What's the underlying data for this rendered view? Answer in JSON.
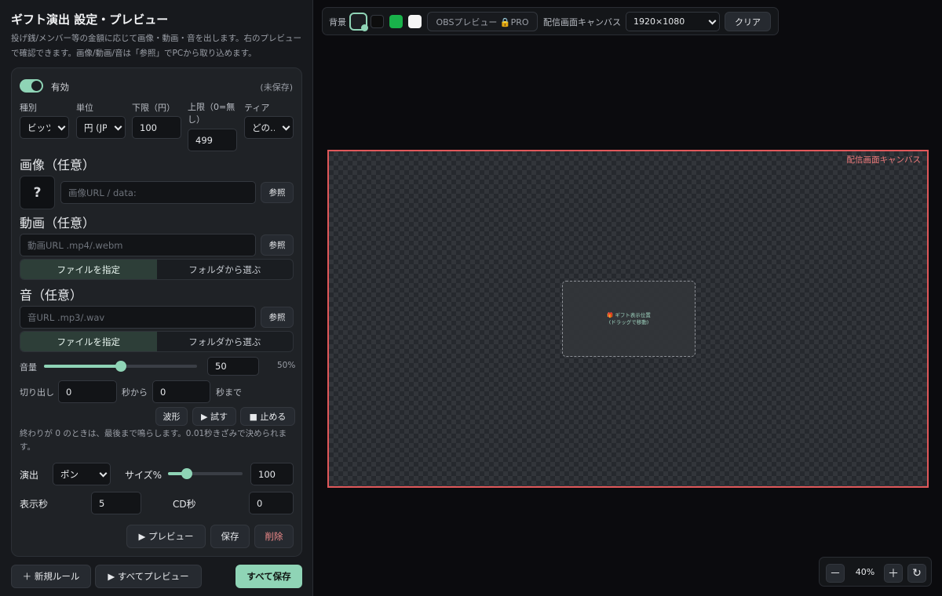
{
  "panel": {
    "title": "ギフト演出 設定・プレビュー",
    "description": "投げ銭/メンバー等の金額に応じて画像・動画・音を出します。右のプレビューで確認できます。画像/動画/音は「参照」でPCから取り込めます。"
  },
  "rule": {
    "enabled_label": "有効",
    "enabled": true,
    "unsaved_label": "(未保存)",
    "fields": {
      "kind_label": "種別",
      "kind_value": "ビッツ",
      "unit_label": "単位",
      "unit_value": "円 (JPY)",
      "min_label": "下限（円）",
      "min_value": "100",
      "max_label": "上限（0=無し）",
      "max_value": "499",
      "tier_label": "ティア",
      "tier_value": "どの…"
    },
    "image": {
      "heading": "画像（任意）",
      "preview_glyph": "?",
      "url_placeholder": "画像URL / data:",
      "browse_label": "参照"
    },
    "video": {
      "heading": "動画（任意）",
      "url_placeholder": "動画URL .mp4/.webm",
      "browse_label": "参照",
      "seg_file": "ファイルを指定",
      "seg_folder": "フォルダから選ぶ"
    },
    "sound": {
      "heading": "音（任意）",
      "url_placeholder": "音URL .mp3/.wav",
      "browse_label": "参照",
      "seg_file": "ファイルを指定",
      "seg_folder": "フォルダから選ぶ",
      "volume_label": "音量",
      "volume_value": "50",
      "volume_percent": "50%",
      "volume_level": 0.5,
      "trim_label": "切り出し",
      "trim_start": "0",
      "trim_from": "秒から",
      "trim_end": "0",
      "trim_to": "秒まで",
      "waveform_label": "波形",
      "try_label": "▶ 試す",
      "stop_label": "■ 止める",
      "note": "終わりが 0 のときは、最後まで鳴らします。0.01秒きざみで決められます。"
    },
    "effect": {
      "effect_label": "演出",
      "effect_value": "ポン",
      "size_label": "サイズ%",
      "size_value": "100",
      "size_level": 0.25,
      "duration_label": "表示秒",
      "duration_value": "5",
      "cd_label": "CD秒",
      "cd_value": "0"
    },
    "actions": {
      "preview": "▶ プレビュー",
      "save": "保存",
      "delete": "削除"
    }
  },
  "footer": {
    "new_rule": "＋ 新規ルール",
    "preview_all": "▶ すべてプレビュー",
    "save_all": "すべて保存"
  },
  "toolbar": {
    "bg_label": "背景",
    "bg_swatch_colors": [
      "#1b1e22",
      "#0d0d0d",
      "#19b24a",
      "#f5f5f5"
    ],
    "obs_preview": "OBSプレビュー 🔒PRO",
    "canvas_label": "配信画面キャンバス",
    "resolution": "1920×1080",
    "clear": "クリア"
  },
  "canvas": {
    "label": "配信画面キャンバス",
    "gift_line1": "🎁 ギフト表示位置",
    "gift_line2": "(ドラッグで移動)"
  },
  "zoom": {
    "minus": "－",
    "value": "40%",
    "plus": "＋",
    "reset_icon": "↻"
  },
  "colors": {
    "accent": "#8fd4b6",
    "canvas_border": "#e0585a",
    "danger_text": "#f08a8a"
  }
}
